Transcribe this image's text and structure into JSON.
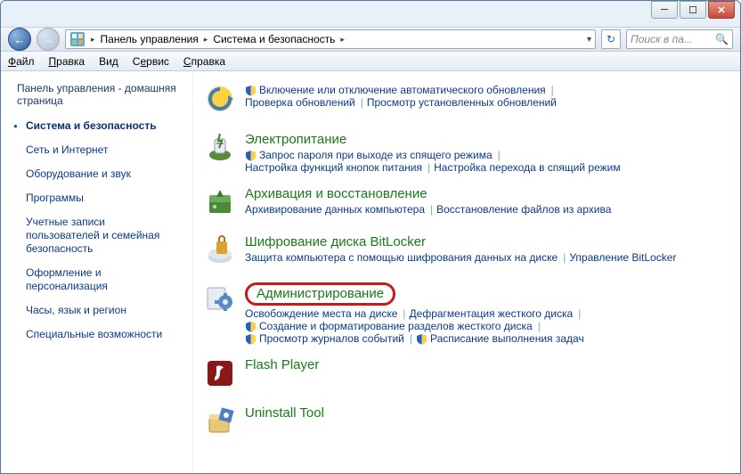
{
  "breadcrumb": {
    "root": "Панель управления",
    "sub": "Система и безопасность"
  },
  "search": {
    "placeholder": "Поиск в па..."
  },
  "menu": {
    "file": "Файл",
    "edit": "Правка",
    "view": "Вид",
    "tools": "Сервис",
    "help": "Справка"
  },
  "sidebar": {
    "title": "Панель управления - домашняя страница",
    "items": [
      {
        "label": "Система и безопасность",
        "active": true
      },
      {
        "label": "Сеть и Интернет"
      },
      {
        "label": "Оборудование и звук"
      },
      {
        "label": "Программы"
      },
      {
        "label": "Учетные записи пользователей и семейная безопасность"
      },
      {
        "label": "Оформление и персонализация"
      },
      {
        "label": "Часы, язык и регион"
      },
      {
        "label": "Специальные возможности"
      }
    ]
  },
  "main": {
    "top_links": [
      {
        "label": "Включение или отключение автоматического обновления",
        "shield": true
      },
      {
        "label": "Проверка обновлений"
      },
      {
        "label": "Просмотр установленных обновлений"
      }
    ],
    "categories": [
      {
        "title": "Электропитание",
        "links": [
          {
            "label": "Запрос пароля при выходе из спящего режима",
            "shield": true
          },
          {
            "label": "Настройка функций кнопок питания"
          },
          {
            "label": "Настройка перехода в спящий режим"
          }
        ]
      },
      {
        "title": "Архивация и восстановление",
        "links": [
          {
            "label": "Архивирование данных компьютера"
          },
          {
            "label": "Восстановление файлов из архива"
          }
        ]
      },
      {
        "title": "Шифрование диска BitLocker",
        "links": [
          {
            "label": "Защита компьютера с помощью шифрования данных на диске"
          },
          {
            "label": "Управление BitLocker"
          }
        ]
      },
      {
        "title": "Администрирование",
        "highlight": true,
        "links": [
          {
            "label": "Освобождение места на диске"
          },
          {
            "label": "Дефрагментация жесткого диска"
          },
          {
            "label": "Создание и форматирование разделов жесткого диска",
            "shield": true
          },
          {
            "label": "Просмотр журналов событий",
            "shield": true
          },
          {
            "label": "Расписание выполнения задач",
            "shield": true
          }
        ]
      },
      {
        "title": "Flash Player",
        "links": []
      },
      {
        "title": "Uninstall Tool",
        "links": []
      }
    ]
  }
}
